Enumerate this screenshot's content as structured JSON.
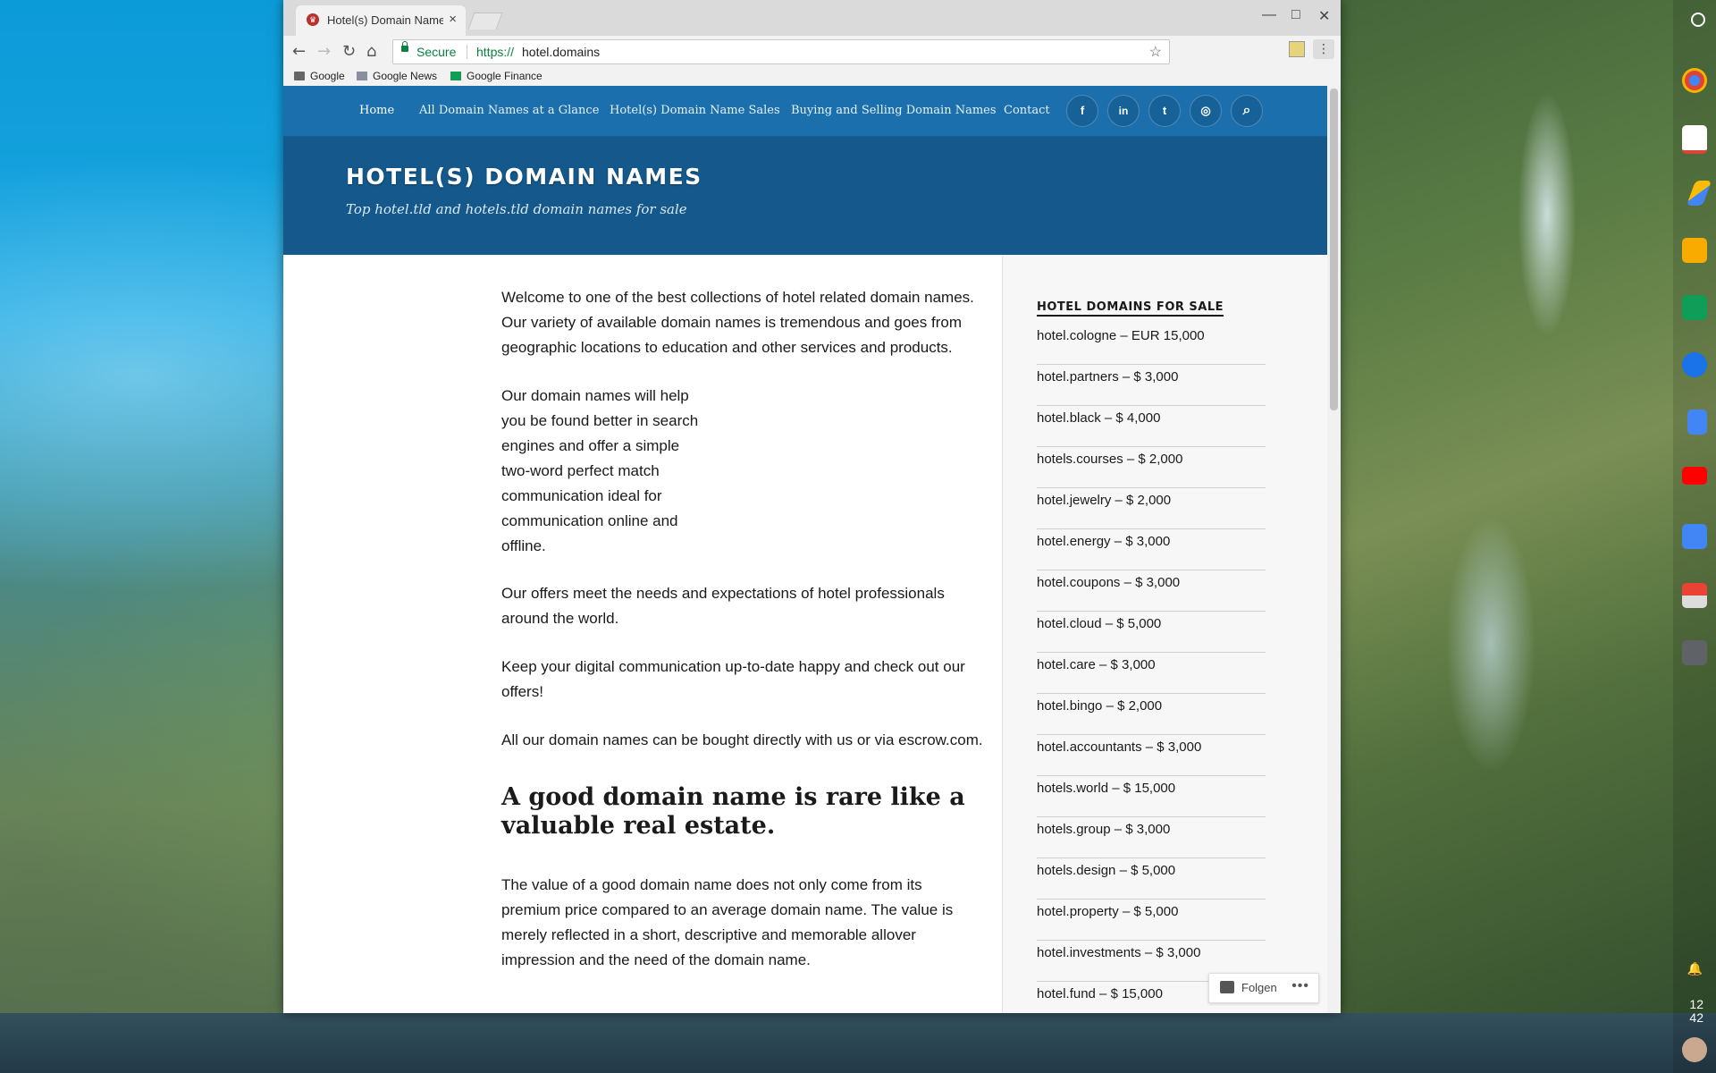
{
  "browser": {
    "tab_title": "Hotel(s) Domain Names",
    "tab_close": "×",
    "window_controls": {
      "minimize": "—",
      "maximize": "□",
      "close": "✕"
    },
    "nav": {
      "back": "←",
      "forward": "→",
      "reload": "↻",
      "home": "⌂"
    },
    "omnibox": {
      "secure_label": "Secure",
      "scheme": "https://",
      "host": "hotel.domains"
    },
    "bookmarks": [
      "Google",
      "Google News",
      "Google Finance"
    ]
  },
  "site": {
    "nav": [
      "Home",
      "All Domain Names at a Glance",
      "Hotel(s) Domain Name Sales",
      "Buying and Selling Domain Names",
      "Contact"
    ],
    "social_icons": [
      "facebook-icon",
      "linkedin-icon",
      "twitter-icon",
      "instagram-icon",
      "search-icon"
    ],
    "social_glyphs": [
      "f",
      "in",
      "t",
      "◎",
      "⌕"
    ],
    "title": "HOTEL(S) DOMAIN NAMES",
    "tagline": "Top hotel.tld and hotels.tld domain names for sale"
  },
  "content": {
    "p1": "Welcome to one of the best collections of hotel related domain names. Our variety of available domain names is tremendous and goes from geographic locations to education and other services and products.",
    "p2": "Our domain names will help you be found better in search engines and offer a simple two-word perfect match communication ideal for communication online and offline.",
    "p3": "Our offers meet the needs and expectations of hotel professionals around the world.",
    "p4": "Keep your digital communication up-to-date happy and check out our offers!",
    "p5": "All our domain names can be bought directly with us or via escrow.com.",
    "heading": "A good domain name is rare like a valuable real estate.",
    "p6": "The value of a good domain name does not only come from its premium price compared to an average domain name. The value is merely reflected in a short, descriptive and memorable allover impression and the need of the domain name."
  },
  "sidebar": {
    "title": "HOTEL DOMAINS FOR SALE",
    "domains": [
      "hotel.cologne – EUR 15,000",
      "hotel.partners – $ 3,000",
      "hotel.black – $ 4,000",
      "hotels.courses – $ 2,000",
      "hotel.jewelry – $ 2,000",
      "hotel.energy – $ 3,000",
      "hotel.coupons – $ 3,000",
      "hotel.cloud – $ 5,000",
      "hotel.care – $ 3,000",
      "hotel.bingo – $ 2,000",
      "hotel.accountants – $ 3,000",
      "hotels.world – $ 15,000",
      "hotels.group – $ 3,000",
      "hotels.design – $ 5,000",
      "hotel.property – $ 5,000",
      "hotel.investments – $ 3,000",
      "hotel.fund – $ 15,000"
    ]
  },
  "follow": {
    "label": "Folgen",
    "more": "•••"
  },
  "system": {
    "time_hour": "12",
    "time_min": "42"
  }
}
